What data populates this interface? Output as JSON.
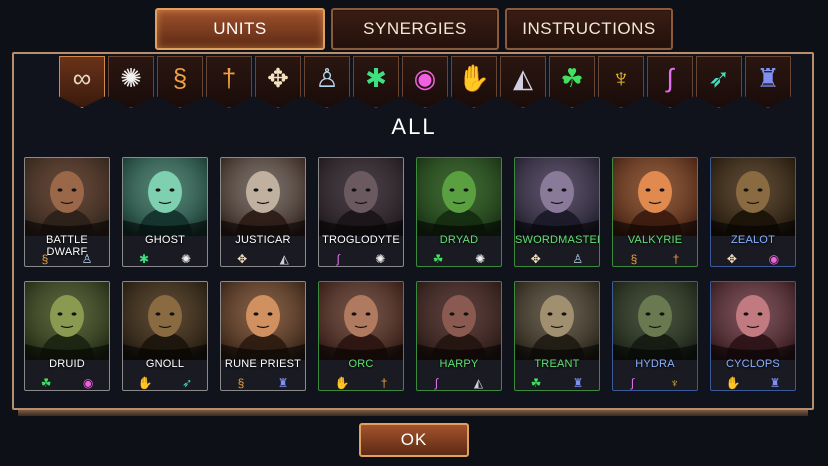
{
  "tabs": [
    {
      "label": "UNITS",
      "active": true
    },
    {
      "label": "SYNERGIES",
      "active": false
    },
    {
      "label": "INSTRUCTIONS",
      "active": false
    }
  ],
  "filters": [
    {
      "icon": "infinity-icon",
      "glyph": "∞",
      "color": "#e8d8c8",
      "active": true
    },
    {
      "icon": "spiral-icon",
      "glyph": "✺",
      "color": "#f0f0f0"
    },
    {
      "icon": "dragon-icon",
      "glyph": "§",
      "color": "#f0a040"
    },
    {
      "icon": "sword-icon",
      "glyph": "†",
      "color": "#f0a040"
    },
    {
      "icon": "cross-knot-icon",
      "glyph": "✥",
      "color": "#f4e2c0"
    },
    {
      "icon": "knight-icon",
      "glyph": "♙",
      "color": "#b8d8f0"
    },
    {
      "icon": "spider-icon",
      "glyph": "✱",
      "color": "#40e080"
    },
    {
      "icon": "crystal-ball-icon",
      "glyph": "◉",
      "color": "#f060e0"
    },
    {
      "icon": "hand-icon",
      "glyph": "✋",
      "color": "#f04040"
    },
    {
      "icon": "hood-icon",
      "glyph": "◭",
      "color": "#cfcfdf"
    },
    {
      "icon": "triquetra-icon",
      "glyph": "☘",
      "color": "#40e060"
    },
    {
      "icon": "demon-icon",
      "glyph": "♆",
      "color": "#f0c030"
    },
    {
      "icon": "serpent-icon",
      "glyph": "∫",
      "color": "#e070f0"
    },
    {
      "icon": "arrows-icon",
      "glyph": "➶",
      "color": "#40e0c0"
    },
    {
      "icon": "golem-icon",
      "glyph": "♜",
      "color": "#8090f0"
    }
  ],
  "section_title": "ALL",
  "units": [
    {
      "name": "BATTLE DWARF",
      "name_color": "#ffffff",
      "border": "#8a8a8a",
      "skin": "#9a6848",
      "bg": "#2a2018",
      "icons": [
        [
          "§",
          "#f0a040"
        ],
        [
          "♙",
          "#b8d8f0"
        ]
      ]
    },
    {
      "name": "GHOST",
      "name_color": "#ffffff",
      "border": "#8a8a8a",
      "skin": "#7fd0b0",
      "bg": "#12302a",
      "icons": [
        [
          "✱",
          "#40e080"
        ],
        [
          "✺",
          "#f0f0f0"
        ]
      ]
    },
    {
      "name": "JUSTICAR",
      "name_color": "#ffffff",
      "border": "#8a8a8a",
      "skin": "#c0b0a0",
      "bg": "#2a1a14",
      "icons": [
        [
          "✥",
          "#f4e2c0"
        ],
        [
          "◭",
          "#cfcfdf"
        ]
      ]
    },
    {
      "name": "TROGLODYTE",
      "name_color": "#ffffff",
      "border": "#8a8a8a",
      "skin": "#6a5a60",
      "bg": "#1a1418",
      "icons": [
        [
          "∫",
          "#e070f0"
        ],
        [
          "✺",
          "#f0f0f0"
        ]
      ]
    },
    {
      "name": "DRYAD",
      "name_color": "#60e070",
      "border": "#3c8a3c",
      "skin": "#5aa040",
      "bg": "#142a10",
      "icons": [
        [
          "☘",
          "#40e060"
        ],
        [
          "✺",
          "#f0f0f0"
        ]
      ]
    },
    {
      "name": "SWORDMASTER",
      "name_color": "#60e070",
      "border": "#3c8a3c",
      "skin": "#8a7a9a",
      "bg": "#1a1826",
      "icons": [
        [
          "✥",
          "#f4e2c0"
        ],
        [
          "♙",
          "#b8d8f0"
        ]
      ]
    },
    {
      "name": "VALKYRIE",
      "name_color": "#60e070",
      "border": "#3c8a3c",
      "skin": "#e08a50",
      "bg": "#3a1a0e",
      "icons": [
        [
          "§",
          "#f0a040"
        ],
        [
          "†",
          "#f0a040"
        ]
      ]
    },
    {
      "name": "ZEALOT",
      "name_color": "#8ab0ff",
      "border": "#3a5a9a",
      "skin": "#8a6a40",
      "bg": "#1a1208",
      "icons": [
        [
          "✥",
          "#f4e2c0"
        ],
        [
          "◉",
          "#f060e0"
        ]
      ]
    },
    {
      "name": "DRUID",
      "name_color": "#ffffff",
      "border": "#8a8a8a",
      "skin": "#8a9a50",
      "bg": "#1a2210",
      "icons": [
        [
          "☘",
          "#40e060"
        ],
        [
          "◉",
          "#f060e0"
        ]
      ]
    },
    {
      "name": "GNOLL",
      "name_color": "#ffffff",
      "border": "#8a8a8a",
      "skin": "#8a6a40",
      "bg": "#1a140c",
      "icons": [
        [
          "✋",
          "#f04040"
        ],
        [
          "➶",
          "#40e0c0"
        ]
      ]
    },
    {
      "name": "RUNE PRIEST",
      "name_color": "#ffffff",
      "border": "#8a8a8a",
      "skin": "#d09060",
      "bg": "#2a1a10",
      "icons": [
        [
          "§",
          "#f0a040"
        ],
        [
          "♜",
          "#8090f0"
        ]
      ]
    },
    {
      "name": "ORC",
      "name_color": "#60e070",
      "border": "#3c8a3c",
      "skin": "#b07a60",
      "bg": "#2a1410",
      "icons": [
        [
          "✋",
          "#f04040"
        ],
        [
          "†",
          "#f0a040"
        ]
      ]
    },
    {
      "name": "HARPY",
      "name_color": "#60e070",
      "border": "#3c8a3c",
      "skin": "#8a5a50",
      "bg": "#221410",
      "icons": [
        [
          "∫",
          "#e070f0"
        ],
        [
          "◭",
          "#cfcfdf"
        ]
      ]
    },
    {
      "name": "TREANT",
      "name_color": "#60e070",
      "border": "#3c8a3c",
      "skin": "#a09070",
      "bg": "#1e1a12",
      "icons": [
        [
          "☘",
          "#40e060"
        ],
        [
          "♜",
          "#8090f0"
        ]
      ]
    },
    {
      "name": "HYDRA",
      "name_color": "#8ab0ff",
      "border": "#3a5a9a",
      "skin": "#6a7a50",
      "bg": "#141a12",
      "icons": [
        [
          "∫",
          "#e070f0"
        ],
        [
          "♆",
          "#f0c030"
        ]
      ]
    },
    {
      "name": "CYCLOPS",
      "name_color": "#8ab0ff",
      "border": "#3a5a9a",
      "skin": "#c07a80",
      "bg": "#2a1216",
      "icons": [
        [
          "✋",
          "#f04040"
        ],
        [
          "♜",
          "#8090f0"
        ]
      ]
    }
  ],
  "ok_label": "OK"
}
